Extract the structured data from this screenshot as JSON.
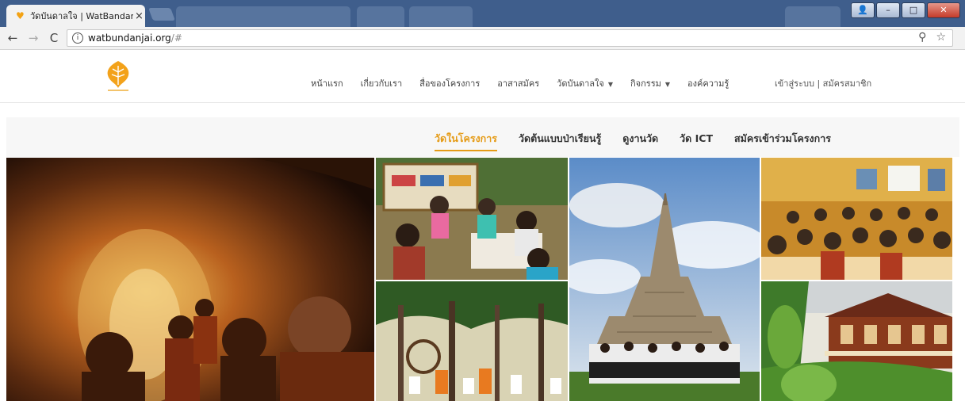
{
  "browser": {
    "tab_title": "วัดบันดาลใจ | WatBandanj",
    "tab_close": "×",
    "url_host": "watbundanjai.org",
    "url_path": "/#"
  },
  "site": {
    "nav": [
      {
        "label": "หน้าแรก"
      },
      {
        "label": "เกี่ยวกับเรา"
      },
      {
        "label": "สื่อของโครงการ"
      },
      {
        "label": "อาสาสมัคร"
      },
      {
        "label": "วัดบันดาลใจ"
      },
      {
        "label": "กิจกรรม"
      },
      {
        "label": "องค์ความรู้"
      }
    ],
    "account": "เข้าสู่ระบบ | สมัครสมาชิก",
    "subnav": [
      {
        "label": "วัดในโครงการ"
      },
      {
        "label": "วัดต้นแบบป่าเรียนรู้"
      },
      {
        "label": "ดูงานวัด"
      },
      {
        "label": "วัด ICT"
      },
      {
        "label": "สมัครเข้าร่วมโครงการ"
      }
    ]
  },
  "colors": {
    "accent": "#e59b16",
    "chrome": "#3f5e8c"
  },
  "icons": {
    "back": "arrow-left-icon",
    "forward": "arrow-right-icon",
    "reload": "reload-icon",
    "info": "info-icon",
    "zoom": "zoom-icon",
    "bookmark": "star-icon"
  }
}
